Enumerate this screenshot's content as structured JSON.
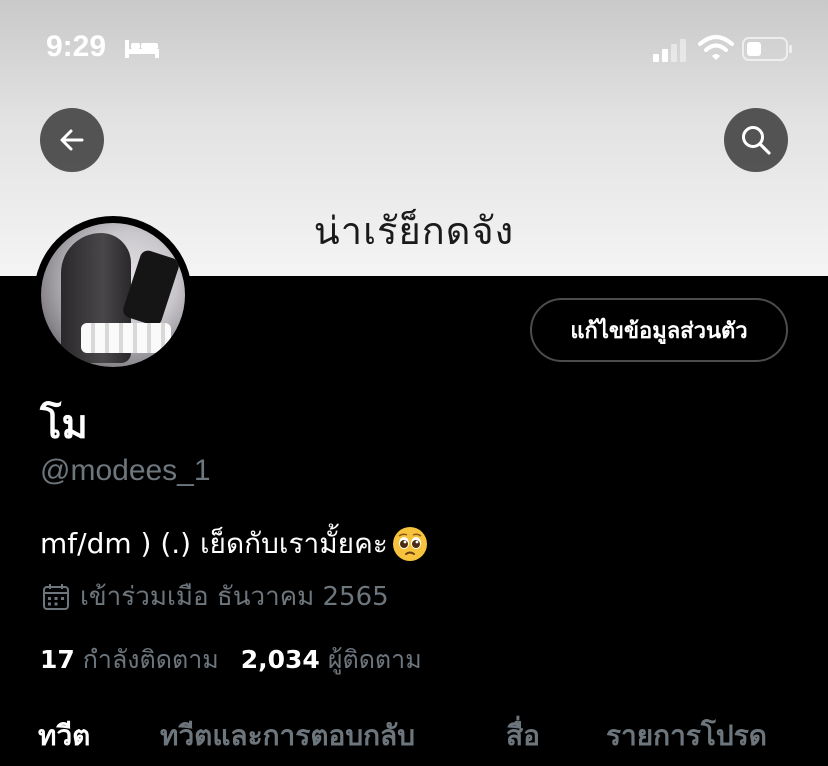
{
  "status_bar": {
    "time": "9:29",
    "icons": [
      "bed-icon",
      "signal-icon",
      "wifi-icon",
      "battery-icon"
    ]
  },
  "banner": {
    "text": "น่าเรัย็กดจัง"
  },
  "nav": {
    "back_icon": "arrow-left-icon",
    "search_icon": "search-icon"
  },
  "profile": {
    "display_name": "โม",
    "handle": "@modees_1",
    "bio": "mf/dm ) (.) เย็ดกับเรามั้ยคะ",
    "bio_emoji": "pleading-face-icon",
    "joined": "เข้าร่วมเมือ ธันวาคม 2565",
    "following_count": "17",
    "following_label": "กำลังติดตาม",
    "followers_count": "2,034",
    "followers_label": "ผู้ติดตาม",
    "edit_button": "แก้ไขข้อมูลส่วนตัว"
  },
  "tabs": [
    {
      "label": "ทวีต",
      "active": true
    },
    {
      "label": "ทวีตและการตอบกลับ",
      "active": false
    },
    {
      "label": "สื่อ",
      "active": false
    },
    {
      "label": "รายการโปรด",
      "active": false
    }
  ],
  "colors": {
    "background": "#000000",
    "secondary_text": "#6e767d",
    "button_border": "#4c4c4c",
    "banner": "#e3e3e3"
  }
}
